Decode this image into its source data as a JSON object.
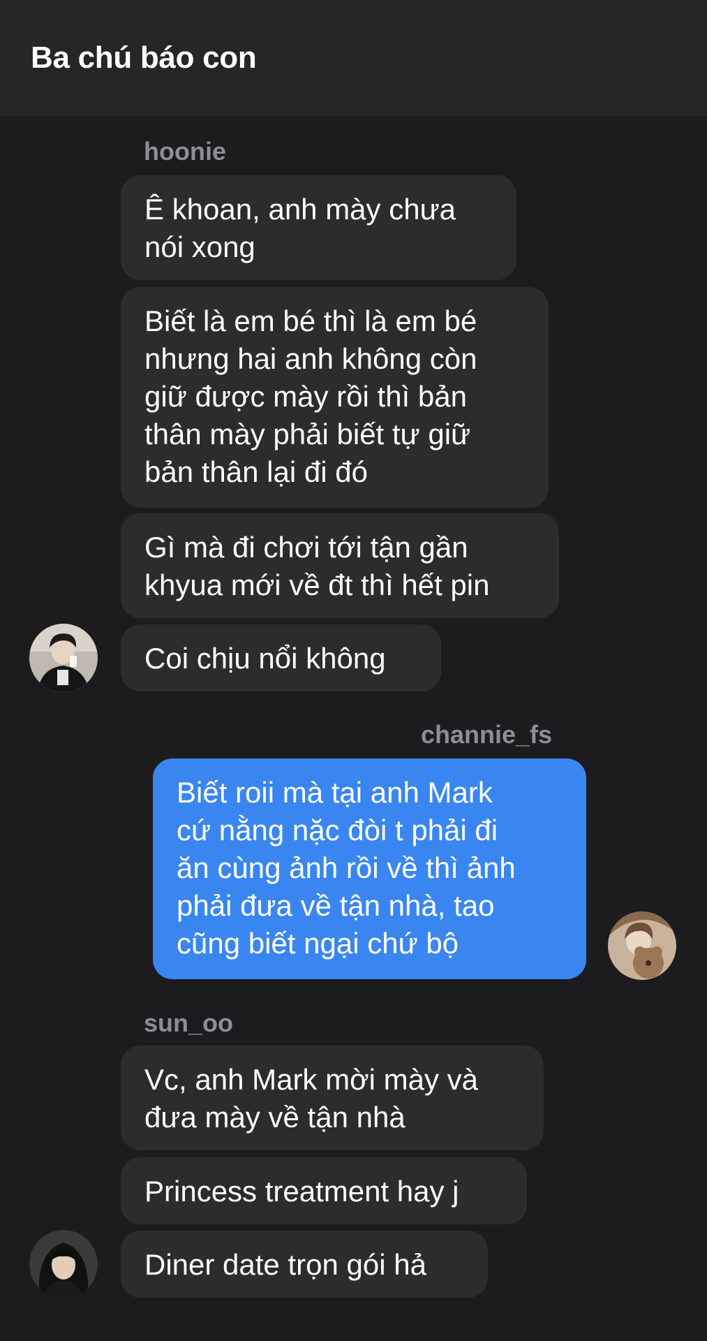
{
  "header": {
    "title": "Ba chú báo con"
  },
  "groups": [
    {
      "sender": "hoonie",
      "messages": [
        "Ê khoan, anh mày chưa\nnói xong",
        "Biết là em bé thì là em bé\nnhưng hai anh không còn\ngiữ được mày rồi thì bản\nthân mày phải biết tự giữ\nbản thân lại đi đó",
        "Gì mà đi chơi tới tận gần\nkhyua mới về đt thì hết pin",
        "Coi chịu nổi không"
      ]
    },
    {
      "sender": "channie_fs",
      "messages": [
        "Biết roii mà tại anh Mark\ncứ nằng nặc đòi t phải đi\năn cùng ảnh rồi về thì ảnh\nphải đưa về tận nhà, tao\ncũng biết ngại chứ bộ"
      ]
    },
    {
      "sender": "sun_oo",
      "messages": [
        "Vc, anh Mark mời mày và\nđưa mày về tận nhà",
        "Princess treatment hay j",
        "Diner date trọn gói hả"
      ]
    }
  ],
  "colors": {
    "background": "#1c1c1e",
    "header": "#262628",
    "incoming_bubble": "#2c2c2e",
    "outgoing_bubble": "#3a86f0",
    "sender_text": "#8e8e93"
  }
}
